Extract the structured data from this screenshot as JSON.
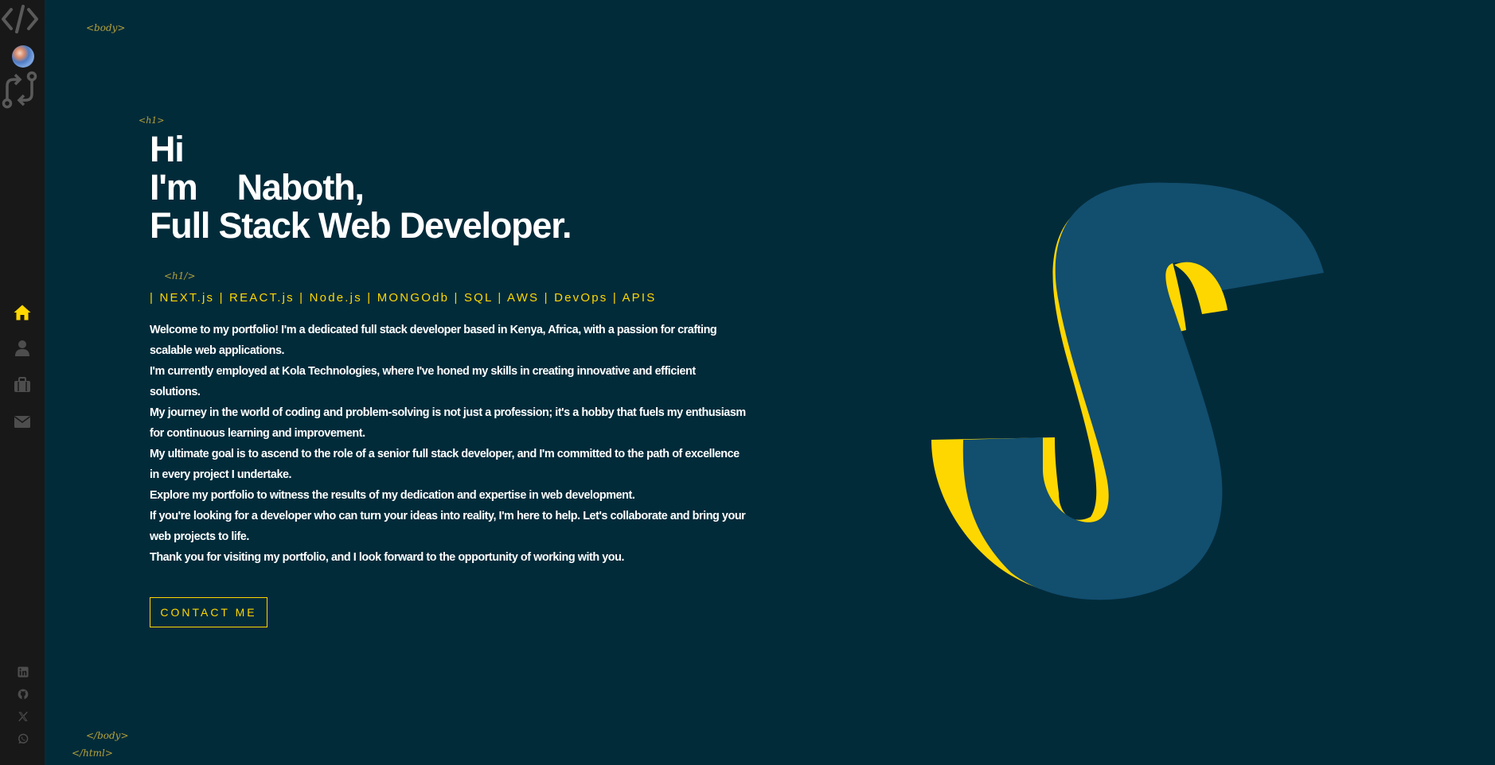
{
  "tags": {
    "body_open": "<body>",
    "h1_open": "<h1>",
    "h1_close": "<h1/>",
    "body_close": "</body>",
    "html_close": "</html>"
  },
  "hero": {
    "line1": "Hi",
    "line2_prefix": "I'm",
    "line2_name": "Naboth,",
    "line3": "Full Stack Web Developer."
  },
  "tech_stack": "| NEXT.js | REACT.js | Node.js | MONGOdb | SQL | AWS | DevOps | APIS",
  "bio": [
    "Welcome to my portfolio! I'm a dedicated full stack developer based in Kenya, Africa, with a passion for crafting scalable web applications.",
    "I'm currently employed at Kola Technologies, where I've honed my skills in creating innovative and efficient solutions.",
    "My journey in the world of coding and problem-solving is not just a profession; it's a hobby that fuels my enthusiasm for continuous learning and improvement.",
    "My ultimate goal is to ascend to the role of a senior full stack developer, and I'm committed to the path of excellence in every project I undertake.",
    "Explore my portfolio to witness the results of my dedication and expertise in web development.",
    "If you're looking for a developer who can turn your ideas into reality, I'm here to help. Let's collaborate and bring your web projects to life.",
    "Thank you for visiting my portfolio, and I look forward to the opportunity of working with you."
  ],
  "contact_button": "CONTACT ME",
  "sidebar": {
    "logo_icon": "code-brackets-icon",
    "avatar": "avatar",
    "git_icon": "git-compare-icon",
    "nav": [
      {
        "icon": "home-icon",
        "active": true
      },
      {
        "icon": "user-icon",
        "active": false
      },
      {
        "icon": "briefcase-icon",
        "active": false
      },
      {
        "icon": "envelope-icon",
        "active": false
      }
    ],
    "social": [
      "linkedin-icon",
      "github-icon",
      "x-icon",
      "whatsapp-icon"
    ]
  },
  "colors": {
    "background": "#022b3a",
    "sidebar": "#181818",
    "accent": "#ffd700",
    "logo_blue": "#124e6e",
    "text": "#ffffff",
    "tag": "#b5a23a",
    "nav_inactive": "#4d4d4e"
  }
}
